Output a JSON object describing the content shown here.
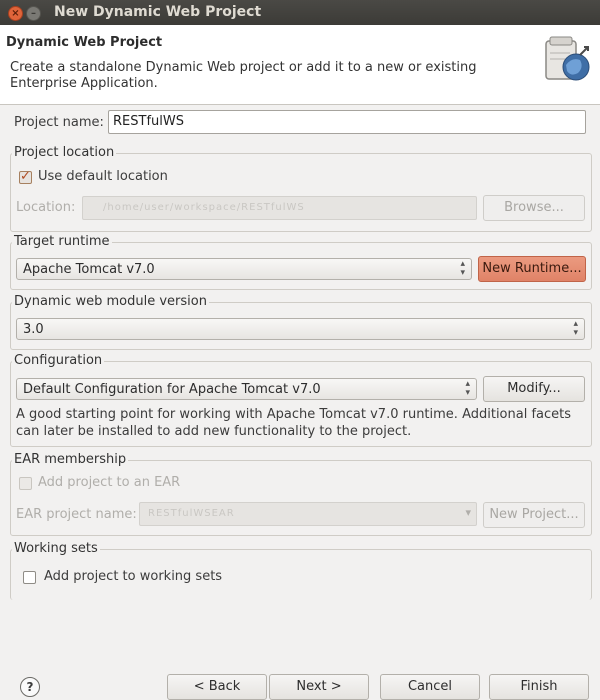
{
  "window": {
    "title": "New Dynamic Web Project",
    "close_glyph": "×",
    "minimize_glyph": "–"
  },
  "header": {
    "title": "Dynamic Web Project",
    "description": "Create a standalone Dynamic Web project or add it to a new or existing Enterprise Application.",
    "icon": "web-project-wizard-icon"
  },
  "project_name": {
    "label": "Project name:",
    "value": "RESTfulWS"
  },
  "project_location": {
    "title": "Project location",
    "use_default_label": "Use default location",
    "use_default_checked": true,
    "location_label": "Location:",
    "location_value": "/home/user/workspace/RESTfulWS",
    "browse_label": "Browse..."
  },
  "target_runtime": {
    "title": "Target runtime",
    "selected": "Apache Tomcat v7.0",
    "new_runtime_label": "New Runtime..."
  },
  "module_version": {
    "title": "Dynamic web module version",
    "selected": "3.0"
  },
  "configuration": {
    "title": "Configuration",
    "selected": "Default Configuration for Apache Tomcat v7.0",
    "modify_label": "Modify...",
    "description": "A good starting point for working with Apache Tomcat v7.0 runtime. Additional facets can later be installed to add new functionality to the project."
  },
  "ear": {
    "title": "EAR membership",
    "add_label": "Add project to an EAR",
    "add_checked": false,
    "name_label": "EAR project name:",
    "name_value": "RESTfulWSEAR",
    "new_project_label": "New Project..."
  },
  "working_sets": {
    "title": "Working sets",
    "add_label": "Add project to working sets",
    "add_checked": false
  },
  "footer": {
    "help_glyph": "?",
    "back_label": "< Back",
    "next_label": "Next >",
    "cancel_label": "Cancel",
    "finish_label": "Finish"
  },
  "colors": {
    "accent_button": "#e08367",
    "titlebar": "#3c3b37",
    "background": "#f2f1f0"
  }
}
